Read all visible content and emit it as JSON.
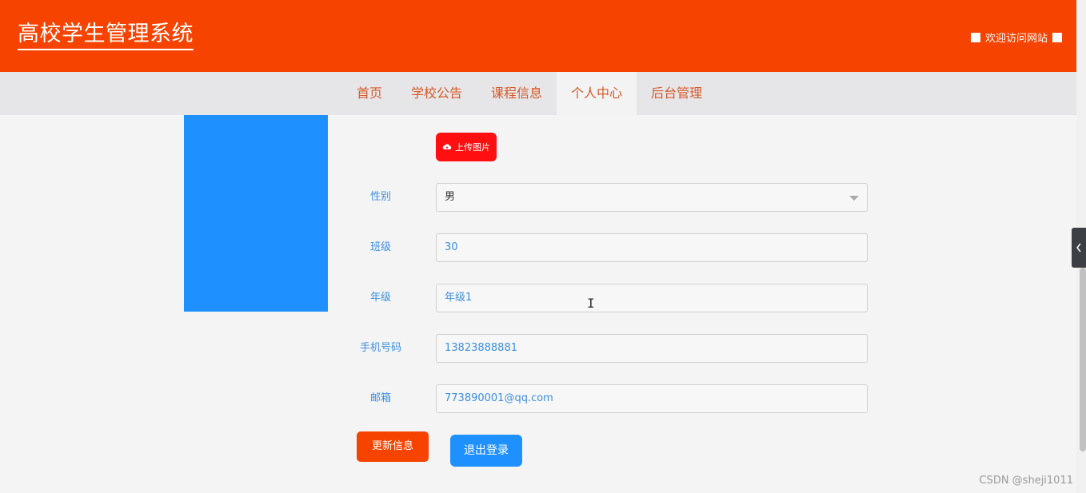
{
  "header": {
    "title": "高校学生管理系统",
    "welcome": "欢迎访问网站"
  },
  "nav": {
    "items": [
      "首页",
      "学校公告",
      "课程信息",
      "个人中心",
      "后台管理"
    ],
    "active_index": 3
  },
  "form": {
    "upload_label": "上传图片",
    "fields": [
      {
        "label": "性别",
        "value": "男"
      },
      {
        "label": "班级",
        "value": "30"
      },
      {
        "label": "年级",
        "value": "年级1"
      },
      {
        "label": "手机号码",
        "value": "13823888881"
      },
      {
        "label": "邮箱",
        "value": "773890001@qq.com"
      }
    ],
    "update_label": "更新信息",
    "logout_label": "退出登录"
  },
  "colors": {
    "header_bg": "#f64400",
    "nav_bg": "#e6e6e8",
    "avatar_bg": "#1e90ff",
    "upload_bg": "#ff0f0f",
    "update_bg": "#f64400",
    "logout_bg": "#1e90ff"
  },
  "icons": {
    "upload": "cloud-upload-icon",
    "sidebar_toggle": "chevron-left-icon",
    "text_cursor": "text-cursor-icon"
  },
  "watermark": "CSDN @sheji1011"
}
